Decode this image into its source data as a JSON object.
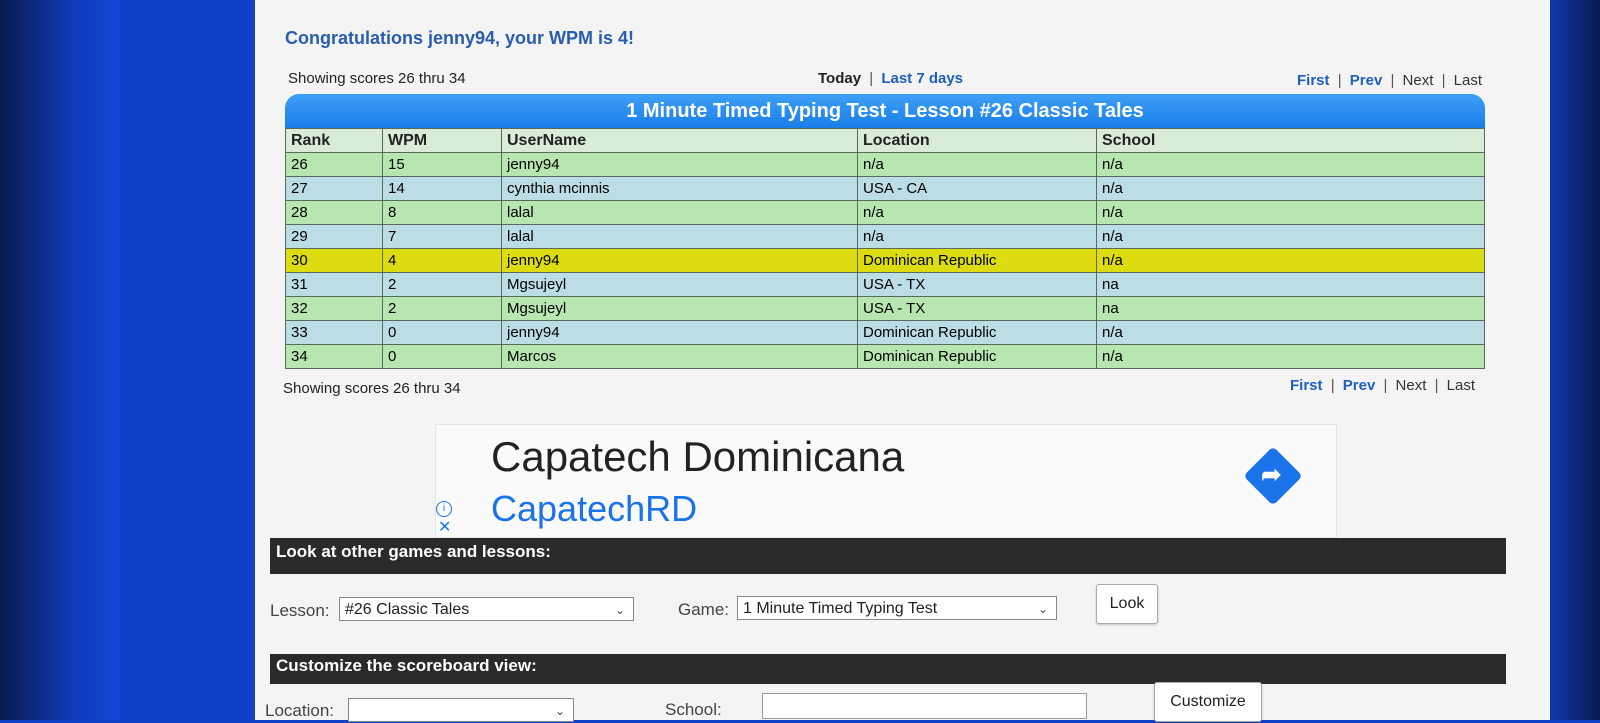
{
  "congrats": "Congratulations jenny94, your WPM is 4!",
  "nav": {
    "showing": "Showing scores 26 thru 34",
    "today": "Today",
    "last7": "Last 7 days",
    "first": "First",
    "prev": "Prev",
    "next": "Next",
    "last": "Last",
    "sep": "|"
  },
  "board": {
    "title": "1 Minute Timed Typing Test - Lesson #26 Classic Tales",
    "headers": [
      "Rank",
      "WPM",
      "UserName",
      "Location",
      "School"
    ],
    "rows": [
      [
        "26",
        "15",
        "jenny94",
        "n/a",
        "n/a"
      ],
      [
        "27",
        "14",
        "cynthia mcinnis",
        "USA - CA",
        "n/a"
      ],
      [
        "28",
        "8",
        "lalal",
        "n/a",
        "n/a"
      ],
      [
        "29",
        "7",
        "lalal",
        "n/a",
        "n/a"
      ],
      [
        "30",
        "4",
        "jenny94",
        "Dominican Republic",
        "n/a"
      ],
      [
        "31",
        "2",
        "Mgsujeyl",
        "USA - TX",
        "na"
      ],
      [
        "32",
        "2",
        "Mgsujeyl",
        "USA - TX",
        "na"
      ],
      [
        "33",
        "0",
        "jenny94",
        "Dominican Republic",
        "n/a"
      ],
      [
        "34",
        "0",
        "Marcos",
        "Dominican Republic",
        "n/a"
      ]
    ]
  },
  "ad": {
    "title": "Capatech Dominicana",
    "subtitle": "CapatechRD",
    "info_icon": "info-icon",
    "close_icon": "close-icon",
    "arrow_icon": "directions-arrow-icon"
  },
  "games": {
    "header": "Look at other games and lessons:",
    "lesson_label": "Lesson:",
    "lesson_value": "#26 Classic Tales",
    "game_label": "Game:",
    "game_value": "1 Minute Timed Typing Test",
    "look_button": "Look"
  },
  "customize": {
    "header": "Customize the scoreboard view:",
    "location_label": "Location:",
    "location_value": "",
    "school_label": "School:",
    "school_value": "",
    "customize_button": "Customize"
  }
}
